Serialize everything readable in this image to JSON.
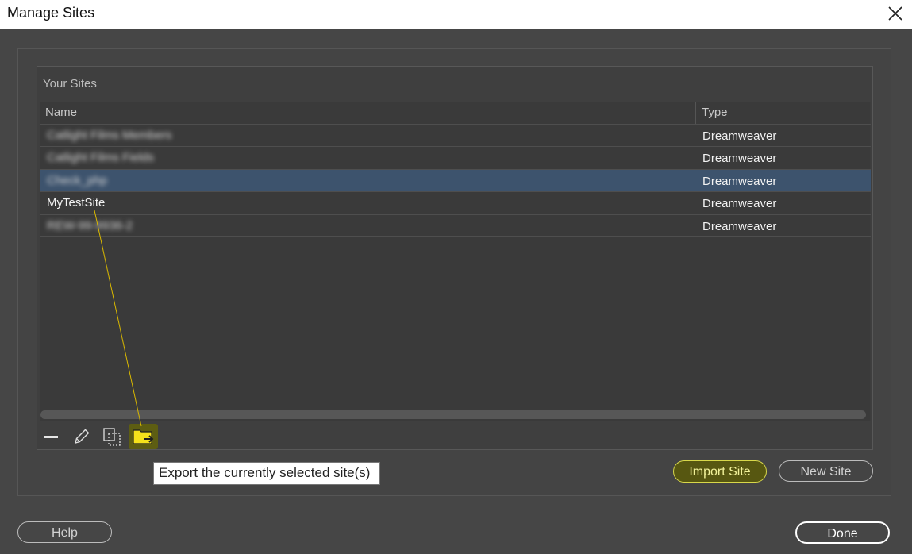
{
  "window": {
    "title": "Manage Sites"
  },
  "panel": {
    "label": "Your Sites"
  },
  "table": {
    "columns": [
      "Name",
      "Type"
    ],
    "rows": [
      {
        "name": "Catlight Films Members",
        "type": "Dreamweaver",
        "selected": false,
        "blurred": true
      },
      {
        "name": "Catlight Films Fields",
        "type": "Dreamweaver",
        "selected": false,
        "blurred": true
      },
      {
        "name": "Check_php",
        "type": "Dreamweaver",
        "selected": true,
        "blurred": true
      },
      {
        "name": "MyTestSite",
        "type": "Dreamweaver",
        "selected": false,
        "blurred": false
      },
      {
        "name": "REW-99-9936-2",
        "type": "Dreamweaver",
        "selected": false,
        "blurred": true
      }
    ]
  },
  "toolbar": {
    "icons": [
      "minus-icon",
      "pencil-icon",
      "duplicate-icon",
      "export-folder-icon"
    ],
    "highlighted": "export-folder-icon"
  },
  "tooltip": {
    "text": "Export the currently selected site(s)"
  },
  "buttons": {
    "import": "Import Site",
    "new_site": "New Site",
    "help": "Help",
    "done": "Done"
  },
  "colors": {
    "highlight": "#e6e619",
    "selection": "#3d536d",
    "background": "#464646"
  }
}
